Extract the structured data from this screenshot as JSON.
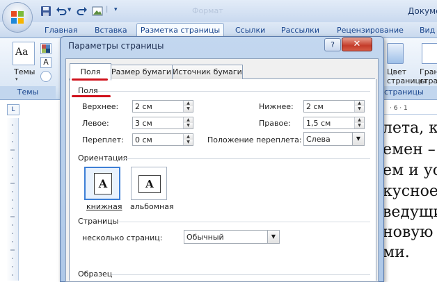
{
  "word": {
    "title_right": "Докуме",
    "title_faded": "Формат",
    "tabs": [
      "Главная",
      "Вставка",
      "Разметка страницы",
      "Ссылки",
      "Рассылки",
      "Рецензирование",
      "Вид"
    ],
    "active_tab": "Разметка страницы",
    "ribbon": {
      "themes_label": "Темы",
      "themes_group_label": "Темы",
      "themes_glyph": "Aa",
      "font_glyph": "A",
      "color_page_label_1": "Цвет",
      "color_page_label_2": "страницы",
      "borders_label_1": "Гран",
      "borders_label_2": "стра",
      "page_bg_group_label": "страницы"
    },
    "ruler_tab_glyph": "L",
    "hruler_text": "· 6 · 1",
    "document_lines": [
      "лета, к",
      "емен – ",
      "ем и ус",
      "кусное",
      "ведущи",
      "новую",
      "ми."
    ]
  },
  "dialog": {
    "title": "Параметры страницы",
    "help_glyph": "?",
    "close_glyph": "✕",
    "tabs": [
      "Поля",
      "Размер бумаги",
      "Источник бумаги"
    ],
    "active_tab": "Поля",
    "margins_section": "Поля",
    "fields": {
      "top": {
        "label": "Верхнее:",
        "value": "2 см"
      },
      "bottom": {
        "label": "Нижнее:",
        "value": "2 см"
      },
      "left": {
        "label": "Левое:",
        "value": "3 см"
      },
      "right": {
        "label": "Правое:",
        "value": "1,5 см"
      },
      "gutter": {
        "label": "Переплет:",
        "value": "0 см"
      },
      "gutter_pos": {
        "label": "Положение переплета:",
        "value": "Слева"
      }
    },
    "orientation_section": "Ориентация",
    "orientation": {
      "portrait": {
        "label": "книжная",
        "glyph": "A"
      },
      "landscape": {
        "label": "альбомная",
        "glyph": "A"
      },
      "selected": "portrait"
    },
    "pages_section": "Страницы",
    "pages": {
      "label": "несколько страниц:",
      "value": "Обычный"
    },
    "sample_section": "Образец"
  },
  "colors": {
    "accent": "#15428b",
    "annotation_red": "#d0111b",
    "close_red": "#c43c2a"
  },
  "icons": {
    "office": "office-logo-icon",
    "save": "save-icon",
    "undo": "undo-icon",
    "redo": "redo-icon",
    "spin": "spinner-arrows-icon",
    "dropdown": "dropdown-arrow-icon"
  }
}
